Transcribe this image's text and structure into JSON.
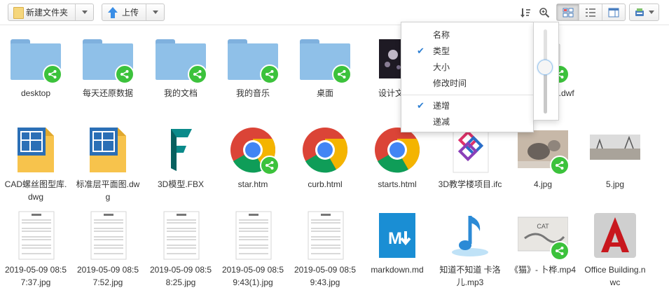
{
  "toolbar": {
    "new_folder_label": "新建文件夹",
    "upload_label": "上传",
    "sort_icon": "sort-icon",
    "zoom_icon": "zoom-in-icon",
    "view_icons": [
      "grid-large-icon",
      "grid-small-icon",
      "detail-panel-icon"
    ],
    "misc_icon": "cloud-drive-icon"
  },
  "sort_menu": {
    "items": [
      {
        "label": "名称",
        "checked": false
      },
      {
        "label": "类型",
        "checked": true
      },
      {
        "label": "大小",
        "checked": false
      },
      {
        "label": "修改时间",
        "checked": false
      }
    ],
    "order": [
      {
        "label": "递增",
        "checked": true
      },
      {
        "label": "递减",
        "checked": false
      }
    ],
    "zoom_level": 0.55
  },
  "files": [
    {
      "name": "desktop",
      "type": "folder",
      "shared": true
    },
    {
      "name": "每天还原数据",
      "type": "folder",
      "shared": true
    },
    {
      "name": "我的文档",
      "type": "folder",
      "shared": true
    },
    {
      "name": "我的音乐",
      "type": "folder",
      "shared": true
    },
    {
      "name": "桌面",
      "type": "folder",
      "shared": true
    },
    {
      "name": "设计文稿 i",
      "type": "image-dark",
      "shared": false
    },
    {
      "name": "wf",
      "type": "hidden",
      "shared": false
    },
    {
      "name": "3D-汽车模型.dwfx",
      "type": "dwfx",
      "shared": true
    },
    {
      "name": "CAD螺丝图型库.dwg",
      "type": "dwg",
      "shared": false
    },
    {
      "name": "标准层平面图.dwg",
      "type": "dwg",
      "shared": false
    },
    {
      "name": "3D模型.FBX",
      "type": "fbx",
      "shared": false
    },
    {
      "name": "star.htm",
      "type": "chrome",
      "shared": true
    },
    {
      "name": "curb.html",
      "type": "chrome",
      "shared": false
    },
    {
      "name": "starts.html",
      "type": "chrome",
      "shared": false
    },
    {
      "name": "3D教学楼项目.ifc",
      "type": "ifc",
      "shared": false
    },
    {
      "name": "4.jpg",
      "type": "photo-cat",
      "shared": true
    },
    {
      "name": "5.jpg",
      "type": "photo-land",
      "shared": false
    },
    {
      "name": "2019-05-09 08:57:37.jpg",
      "type": "sheet",
      "shared": false
    },
    {
      "name": "2019-05-09 08:57:52.jpg",
      "type": "sheet",
      "shared": false
    },
    {
      "name": "2019-05-09 08:58:25.jpg",
      "type": "sheet",
      "shared": false
    },
    {
      "name": "2019-05-09 08:59:43(1).jpg",
      "type": "sheet",
      "shared": false
    },
    {
      "name": "2019-05-09 08:59:43.jpg",
      "type": "sheet",
      "shared": false
    },
    {
      "name": "markdown.md",
      "type": "md",
      "shared": false
    },
    {
      "name": "知道不知道 卡洛儿.mp3",
      "type": "mp3",
      "shared": false
    },
    {
      "name": "《猫》- 卜桦.mp4",
      "type": "video",
      "shared": true
    },
    {
      "name": "Office Building.nwc",
      "type": "nwc",
      "shared": false
    }
  ]
}
